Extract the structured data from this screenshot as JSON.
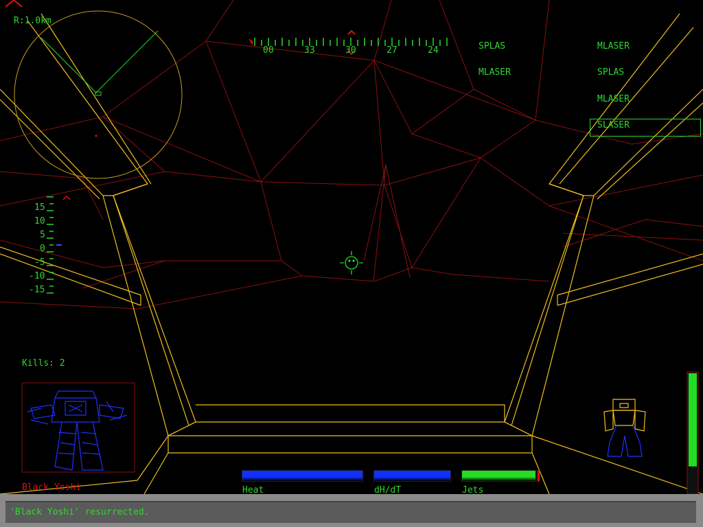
{
  "radar": {
    "range_label": "R:1.0km"
  },
  "compass": {
    "labels": [
      "00",
      "33",
      "30",
      "27",
      "24"
    ]
  },
  "pitch_ladder": {
    "labels": [
      "15",
      "10",
      "5",
      "0",
      "-5",
      "-10",
      "-15"
    ]
  },
  "kills": "Kills: 2",
  "weapons_left": [
    {
      "label": "SPLAS",
      "selected": false
    },
    {
      "label": "MLASER",
      "selected": false
    }
  ],
  "weapons_right": [
    {
      "label": "MLASER",
      "selected": false
    },
    {
      "label": "SPLAS",
      "selected": false
    },
    {
      "label": "MLASER",
      "selected": false
    },
    {
      "label": "SLASER",
      "selected": true
    }
  ],
  "target": {
    "name": "Black Yoshi"
  },
  "gauges": {
    "heat": {
      "label": "Heat",
      "fill": 1.0,
      "color": "#1030ff"
    },
    "dhdt": {
      "label": "dH/dT",
      "fill": 1.0,
      "color": "#1030ff"
    },
    "jets": {
      "label": "Jets",
      "fill": 0.97,
      "color": "#22dd22"
    }
  },
  "throttle": {
    "fill": 0.78,
    "color": "#22dd22"
  },
  "console_message": "'Black Yoshi' resurrected.",
  "colors": {
    "cockpit_frame": "#f0c020",
    "terrain": "#8a1010",
    "hud": "#2fd82f",
    "target_mech": "#2030ff",
    "radar_ring": "#c8a020",
    "alert": "#e01010"
  }
}
